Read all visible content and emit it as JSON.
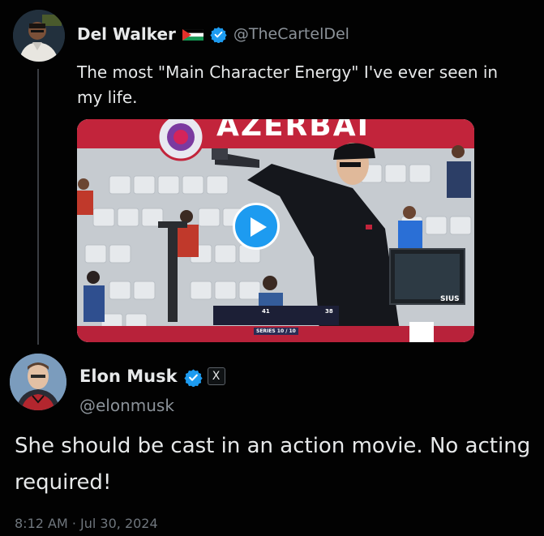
{
  "quoted_tweet": {
    "author_name": "Del Walker",
    "author_handle": "@TheCartelDel",
    "text": "The most \"Main Character Energy\" I've ever seen in my life.",
    "media": {
      "banner_text": "AZERBAI",
      "scoreboard_left": "41",
      "scoreboard_right": "38",
      "series_text": "SERIES 10 / 10",
      "equipment_brand": "SIUS"
    }
  },
  "tweet": {
    "author_name": "Elon Musk",
    "author_handle": "@elonmusk",
    "badge_icon": "X",
    "text": "She should be cast in an action movie. No acting required!",
    "timestamp": "8:12 AM · Jul 30, 2024"
  },
  "colors": {
    "background": "#020202",
    "text_primary": "#e7e9ea",
    "text_secondary": "#8b9299",
    "verified_blue": "#1d9bf0",
    "play_button": "#1d9bf0"
  },
  "icons": {
    "verified": "verified-badge-icon",
    "flag": "palestine-flag-icon",
    "play": "play-icon",
    "x_logo": "x-logo-icon"
  }
}
